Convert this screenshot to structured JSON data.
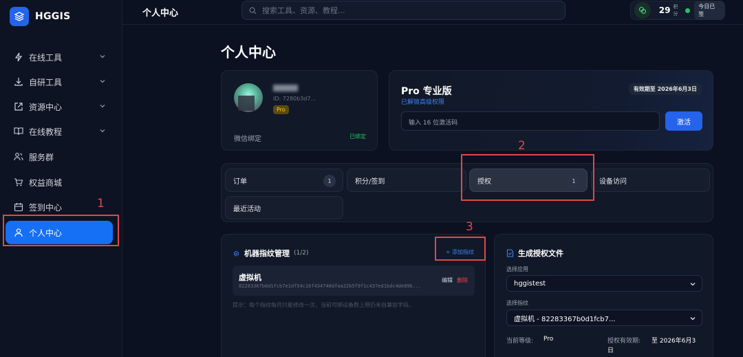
{
  "brand": {
    "name": "HGGIS"
  },
  "sidebar": {
    "items": [
      {
        "label": "在线工具",
        "icon": "lightning-icon",
        "expandable": true
      },
      {
        "label": "自研工具",
        "icon": "download-icon",
        "expandable": true
      },
      {
        "label": "资源中心",
        "icon": "external-link-icon",
        "expandable": true
      },
      {
        "label": "在线教程",
        "icon": "book-icon",
        "expandable": true
      },
      {
        "label": "服务群",
        "icon": "users-icon",
        "expandable": false
      },
      {
        "label": "权益商城",
        "icon": "cart-icon",
        "expandable": false
      },
      {
        "label": "签到中心",
        "icon": "calendar-icon",
        "expandable": false
      },
      {
        "label": "个人中心",
        "icon": "user-icon",
        "expandable": false,
        "active": true
      }
    ]
  },
  "topbar": {
    "title": "个人中心",
    "search_placeholder": "搜索工具、资源、教程...",
    "points_value": "29",
    "points_label": "积分",
    "signed_label": "今日已签"
  },
  "page_title": "个人中心",
  "profile": {
    "uid": "ID: 7280b3d7...",
    "badge": "Pro",
    "wechat_label": "微信绑定",
    "wechat_status": "已绑定"
  },
  "plan": {
    "title": "Pro 专业版",
    "subtitle": "已解锁高级权限",
    "validity": "有效期至 2026年6月3日",
    "code_placeholder": "输入 16 位激活码",
    "activate_label": "激活"
  },
  "tabs": [
    {
      "label": "订单",
      "count": "1"
    },
    {
      "label": "积分/签到",
      "count": ""
    },
    {
      "label": "授权",
      "count": "1",
      "selected": true
    },
    {
      "label": "设备访问",
      "count": ""
    },
    {
      "label": "最近活动",
      "count": ""
    }
  ],
  "fingerprint": {
    "title": "机器指纹管理",
    "count": "(1/2)",
    "add_label": "+ 添加指纹",
    "item_name": "虚拟机",
    "item_hash": "82283367b0d1fcb7e1df54c16f434740dfaa22b5f9f1c437ed1bdc4de89b...",
    "edit_label": "编辑",
    "delete_label": "删除",
    "hint": "提示：每个指纹每月只能修改一次，当前可绑设备数上限仍未自兼容字段。"
  },
  "license": {
    "title": "生成授权文件",
    "app_label": "选择应用",
    "app_value": "hggistest",
    "fp_label": "选择指纹",
    "fp_value": "虚拟机 - 82283367b0d1fcb7...",
    "level_label": "当前等级:",
    "level_value": "Pro",
    "valid_label": "授权有效期:",
    "valid_value_1": "至 2026年6月3",
    "valid_value_2": "日"
  },
  "annotations": {
    "n1": "1",
    "n2": "2",
    "n3": "3"
  },
  "colors": {
    "accent": "#1670f5",
    "annotation": "#e0484e",
    "success": "#22c55e",
    "danger": "#ef4444",
    "gold": "#facc15"
  }
}
